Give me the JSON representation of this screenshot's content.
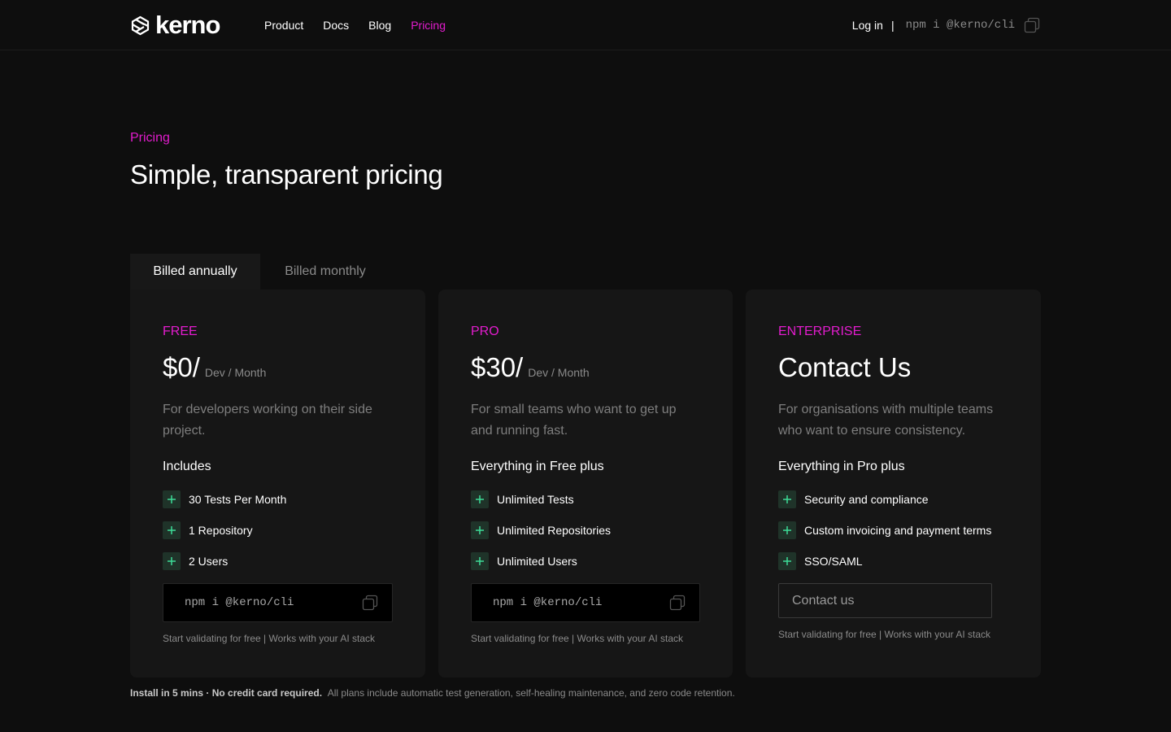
{
  "header": {
    "brand": "kerno",
    "nav": [
      {
        "label": "Product",
        "active": false
      },
      {
        "label": "Docs",
        "active": false
      },
      {
        "label": "Blog",
        "active": false
      },
      {
        "label": "Pricing",
        "active": true
      }
    ],
    "login_label": "Log in",
    "separator": "|",
    "npm_command": "npm i @kerno/cli",
    "copy_icon": "copy-icon"
  },
  "hero": {
    "eyebrow": "Pricing",
    "title": "Simple, transparent pricing"
  },
  "billing": {
    "annual_label": "Billed annually",
    "monthly_label": "Billed monthly",
    "selected": "annual"
  },
  "plans": [
    {
      "name": "FREE",
      "price": "$0/",
      "unit": "Dev / Month",
      "description": "For developers working on their side project.",
      "includes_label": "Includes",
      "features": [
        "30 Tests Per Month",
        "1 Repository",
        "2 Users"
      ],
      "cta_command": "npm i @kerno/cli",
      "note": "Start validating for free | Works with your AI stack"
    },
    {
      "name": "PRO",
      "price": "$30/",
      "unit": "Dev / Month",
      "description": "For small teams who want to get up and running fast.",
      "includes_label": "Everything in Free plus",
      "features": [
        "Unlimited Tests",
        "Unlimited Repositories",
        "Unlimited Users"
      ],
      "cta_command": "npm i @kerno/cli",
      "note": "Start validating for free | Works with your AI stack"
    },
    {
      "name": "ENTERPRISE",
      "title": "Contact Us",
      "description": "For organisations with multiple teams who want to ensure consistency.",
      "includes_label": "Everything in Pro plus",
      "features": [
        "Security and compliance",
        "Custom invoicing and payment terms",
        "SSO/SAML"
      ],
      "cta_label": "Contact us",
      "note": "Start validating for free | Works with your AI stack"
    }
  ],
  "footer": {
    "highlight": "Install in 5 mins · No credit card required.",
    "text": "All plans include automatic test generation, self-healing maintenance, and zero code retention."
  },
  "colors": {
    "accent": "#e21ccd",
    "background": "#0e0e0e",
    "card": "#161616",
    "plus_bg": "#1f3329",
    "plus_fg": "#3ddc97"
  }
}
